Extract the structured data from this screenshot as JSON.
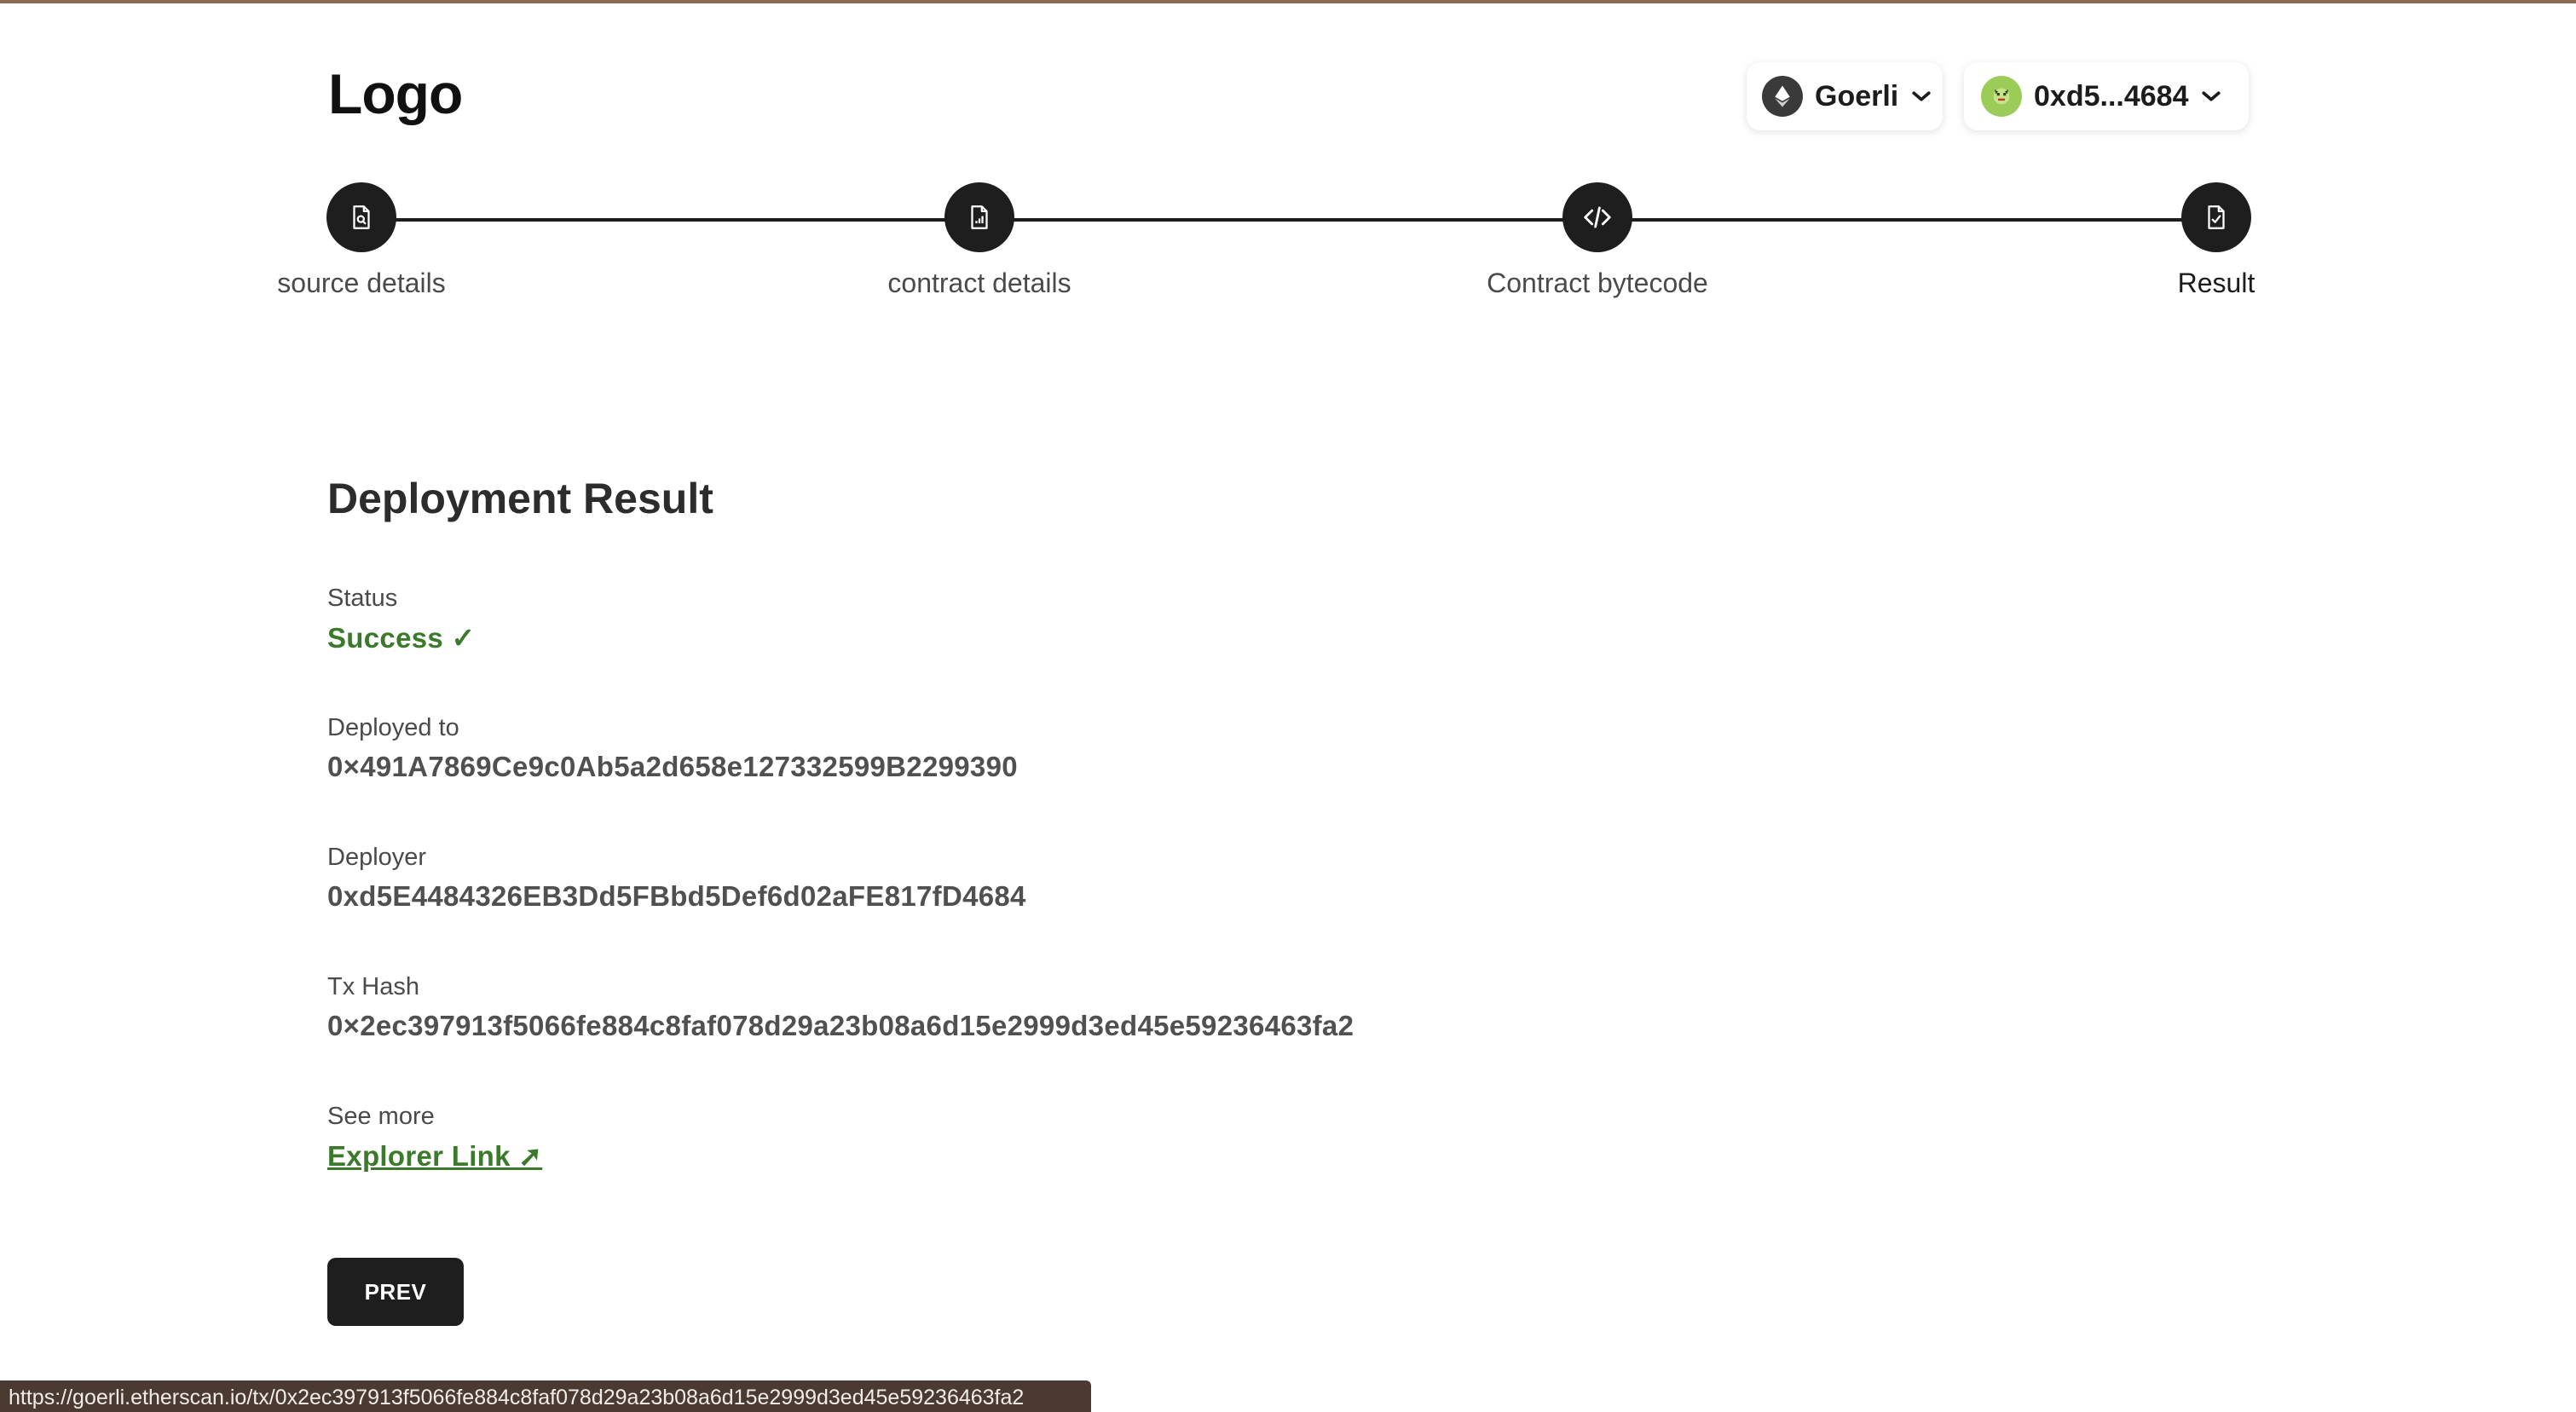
{
  "header": {
    "logo_text": "Logo",
    "network": {
      "label": "Goerli",
      "icon": "ethereum-icon"
    },
    "account": {
      "label": "0xd5...4684",
      "icon": "avatar-icon"
    }
  },
  "stepper": {
    "steps": [
      {
        "label": "source details",
        "icon": "file-search-icon"
      },
      {
        "label": "contract details",
        "icon": "file-chart-icon"
      },
      {
        "label": "Contract bytecode",
        "icon": "code-icon"
      },
      {
        "label": "Result",
        "icon": "file-check-icon"
      }
    ],
    "active_step": "Result"
  },
  "result": {
    "title": "Deployment Result",
    "status": {
      "label": "Status",
      "value": "Success ✓"
    },
    "deployed_to": {
      "label": "Deployed to",
      "value": "0×491A7869Ce9c0Ab5a2d658e127332599B2299390"
    },
    "deployer": {
      "label": "Deployer",
      "value": "0xd5E4484326EB3Dd5FBbd5Def6d02aFE817fD4684"
    },
    "tx_hash": {
      "label": "Tx Hash",
      "value": "0×2ec397913f5066fe884c8faf078d29a23b08a6d15e2999d3ed45e59236463fa2"
    },
    "see_more": {
      "label": "See more",
      "link_text": "Explorer Link ➚"
    }
  },
  "actions": {
    "prev_label": "PREV"
  },
  "browser_status": {
    "url": "https://goerli.etherscan.io/tx/0x2ec397913f5066fe884c8faf078d29a23b08a6d15e2999d3ed45e59236463fa2"
  },
  "colors": {
    "accent_dark": "#1e1e1e",
    "success_green": "#3a7a2a",
    "statusbar_bg": "#4a3a32"
  }
}
